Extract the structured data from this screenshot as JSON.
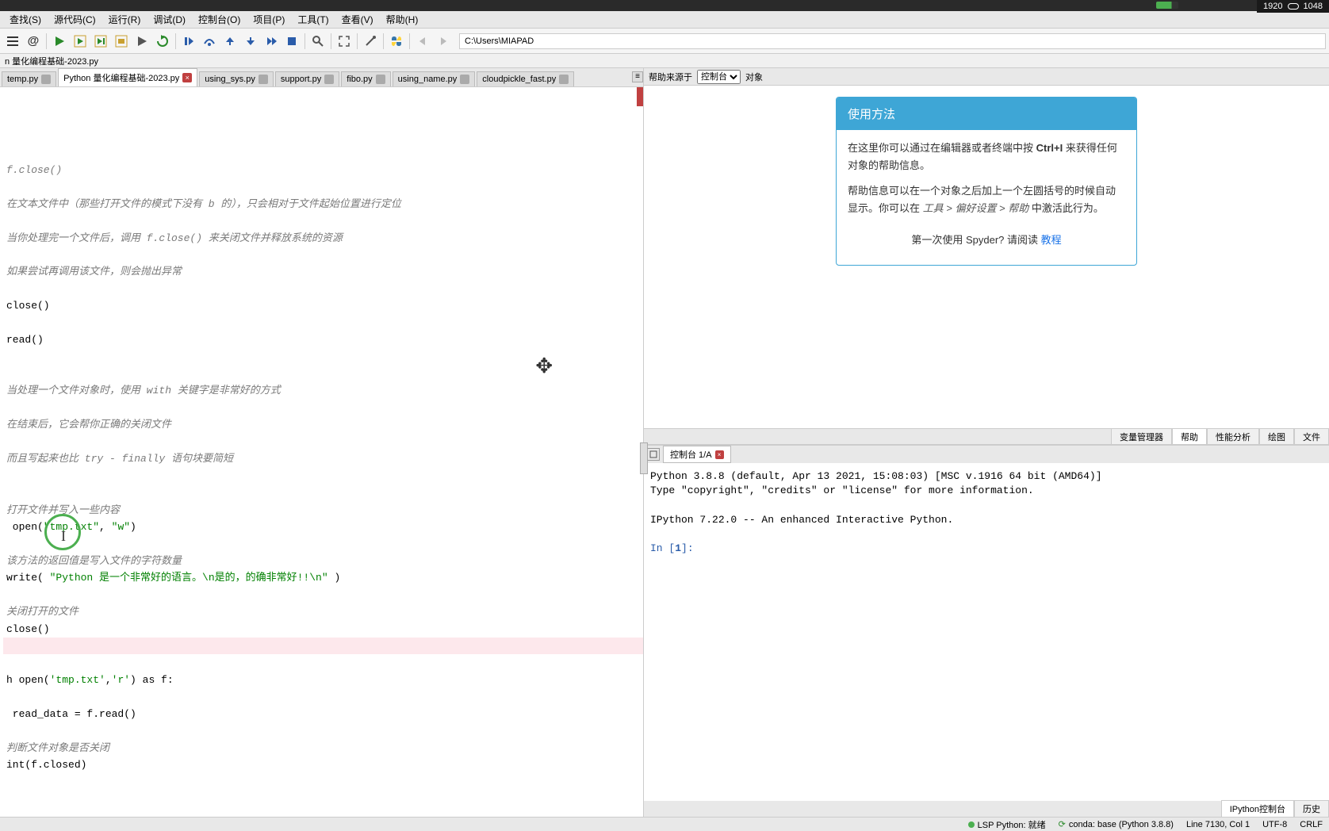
{
  "overlay": {
    "res_w": "1920",
    "res_h": "1048"
  },
  "menus": [
    "查找(S)",
    "源代码(C)",
    "运行(R)",
    "调试(D)",
    "控制台(O)",
    "项目(P)",
    "工具(T)",
    "查看(V)",
    "帮助(H)"
  ],
  "path": "C:\\Users\\MIAPAD",
  "breadcrumb": "n 量化编程基础-2023.py",
  "tabs": [
    {
      "label": "temp.py",
      "active": false
    },
    {
      "label": "Python 量化编程基础-2023.py",
      "active": true
    },
    {
      "label": "using_sys.py",
      "active": false
    },
    {
      "label": "support.py",
      "active": false
    },
    {
      "label": "fibo.py",
      "active": false
    },
    {
      "label": "using_name.py",
      "active": false
    },
    {
      "label": "cloudpickle_fast.py",
      "active": false
    }
  ],
  "code": {
    "l1": "f.close()",
    "l2": "在文本文件中（那些打开文件的模式下没有 b 的），只会相对于文件起始位置进行定位",
    "l3": "当你处理完一个文件后，调用 f.close() 来关闭文件并释放系统的资源",
    "l4": "如果尝试再调用该文件，则会抛出异常",
    "l5": "close()",
    "l6": "read()",
    "l7": "当处理一个文件对象时，使用 with 关键字是非常好的方式",
    "l8": "在结束后，它会帮你正确的关闭文件",
    "l9": "而且写起来也比 try - finally 语句块要简短",
    "l10": "打开文件并写入一些内容",
    "l11a": " open(",
    "l11b": "\"tmp.txt\"",
    "l11c": ", ",
    "l11d": "\"w\"",
    "l11e": ")",
    "l12": "该方法的返回值是写入文件的字符数量",
    "l13a": "write( ",
    "l13b": "\"Python 是一个非常好的语言。\\n是的，的确非常好!!\\n\"",
    "l13c": " )",
    "l14": "关闭打开的文件",
    "l15": "close()",
    "l16a": "h open(",
    "l16b": "'tmp.txt'",
    "l16c": ",",
    "l16d": "'r'",
    "l16e": ") as f:",
    "l17": " read_data = f.read()",
    "l18": "判断文件对象是否关闭",
    "l19": "int(f.closed)"
  },
  "help": {
    "source_label": "帮助来源于",
    "source_value": "控制台",
    "object_label": "对象",
    "card_title": "使用方法",
    "p1a": "在这里你可以通过在编辑器或者终端中按 ",
    "p1b": "Ctrl+I",
    "p1c": " 来获得任何对象的帮助信息。",
    "p2a": "帮助信息可以在一个对象之后加上一个左圆括号的时候自动显示。你可以在 ",
    "p2b": "工具 > 偏好设置 > 帮助",
    "p2c": " 中激活此行为。",
    "footer_text": "第一次使用 Spyder? 请阅读 ",
    "footer_link": "教程",
    "tabs": [
      "变量管理器",
      "帮助",
      "性能分析",
      "绘图",
      "文件"
    ]
  },
  "console": {
    "tab_label": "控制台 1/A",
    "line1": "Python 3.8.8 (default, Apr 13 2021, 15:08:03) [MSC v.1916 64 bit (AMD64)]",
    "line2": "Type \"copyright\", \"credits\" or \"license\" for more information.",
    "line3": "IPython 7.22.0 -- An enhanced Interactive Python.",
    "prompt": "In [",
    "prompt_num": "1",
    "prompt_end": "]:",
    "bottom_tabs": [
      "IPython控制台",
      "历史"
    ]
  },
  "status": {
    "lsp": "LSP Python: 就绪",
    "conda": "conda: base (Python 3.8.8)",
    "line": "Line 7130, Col 1",
    "enc": "UTF-8",
    "eol": "CRLF"
  }
}
